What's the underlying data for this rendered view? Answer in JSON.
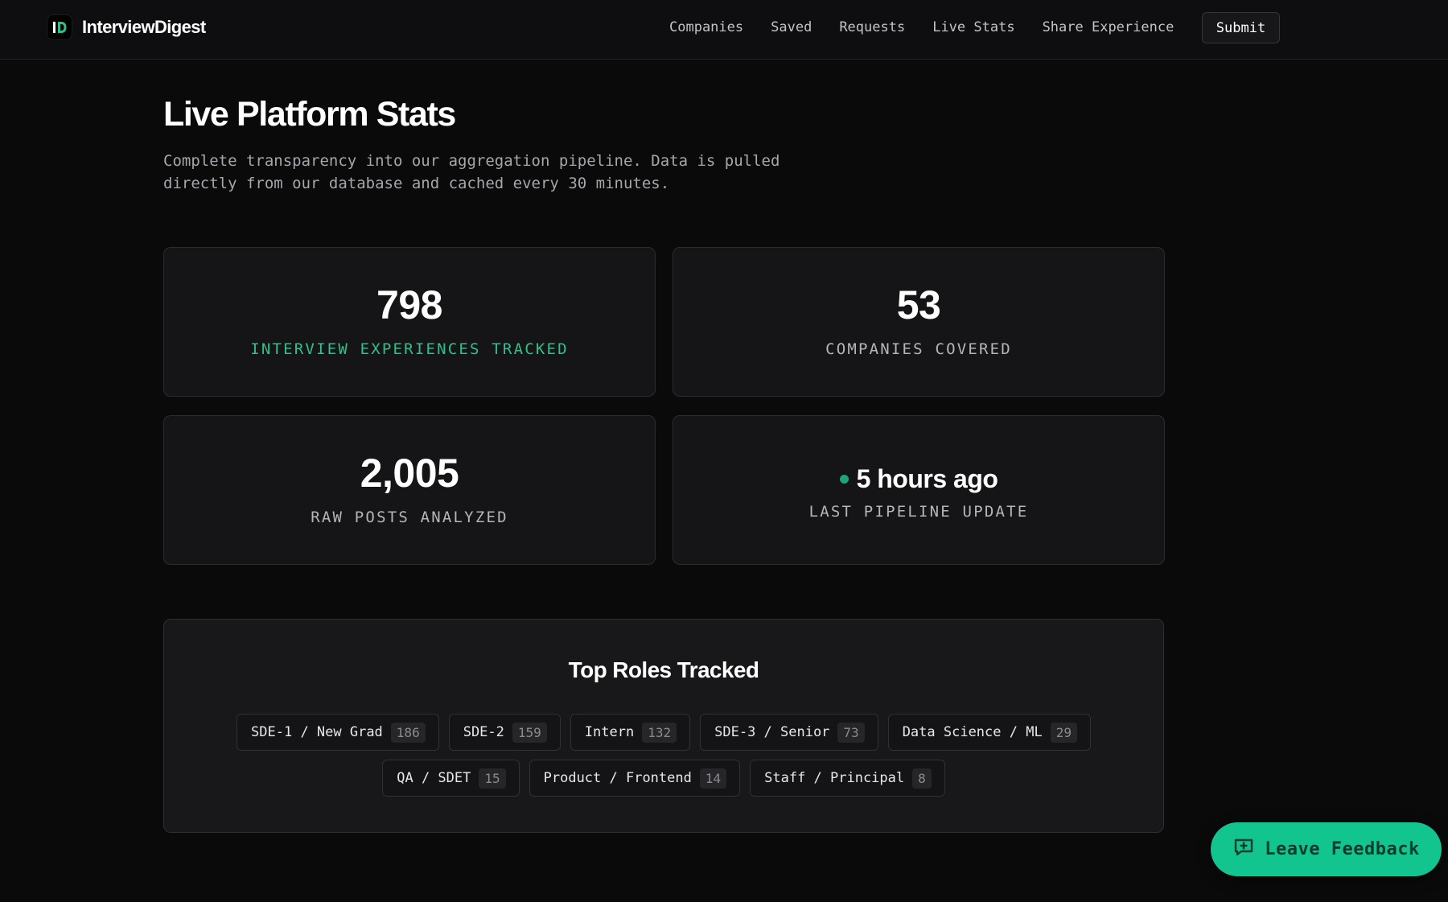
{
  "header": {
    "brand_name": "InterviewDigest",
    "nav": [
      "Companies",
      "Saved",
      "Requests",
      "Live Stats",
      "Share Experience"
    ],
    "submit_label": "Submit"
  },
  "page": {
    "title": "Live Platform Stats",
    "description": "Complete transparency into our aggregation pipeline. Data is pulled directly from our database and cached every 30 minutes."
  },
  "stats": [
    {
      "value": "798",
      "label": "INTERVIEW EXPERIENCES TRACKED",
      "accent": true
    },
    {
      "value": "53",
      "label": "COMPANIES COVERED",
      "accent": false
    },
    {
      "value": "2,005",
      "label": "RAW POSTS ANALYZED",
      "accent": false
    },
    {
      "value": "5 hours ago",
      "label": "LAST PIPELINE UPDATE",
      "accent": false
    }
  ],
  "roles": {
    "title": "Top Roles Tracked",
    "items": [
      {
        "name": "SDE-1 / New Grad",
        "count": "186"
      },
      {
        "name": "SDE-2",
        "count": "159"
      },
      {
        "name": "Intern",
        "count": "132"
      },
      {
        "name": "SDE-3 / Senior",
        "count": "73"
      },
      {
        "name": "Data Science / ML",
        "count": "29"
      },
      {
        "name": "QA / SDET",
        "count": "15"
      },
      {
        "name": "Product / Frontend",
        "count": "14"
      },
      {
        "name": "Staff / Principal",
        "count": "8"
      }
    ]
  },
  "feedback": {
    "label": "Leave Feedback",
    "icon": "message-plus-icon"
  },
  "colors": {
    "accent": "#2fc08c",
    "feedback_bg": "#12c48e",
    "live_dot": "#1fa574",
    "background": "#0a0a0b"
  }
}
